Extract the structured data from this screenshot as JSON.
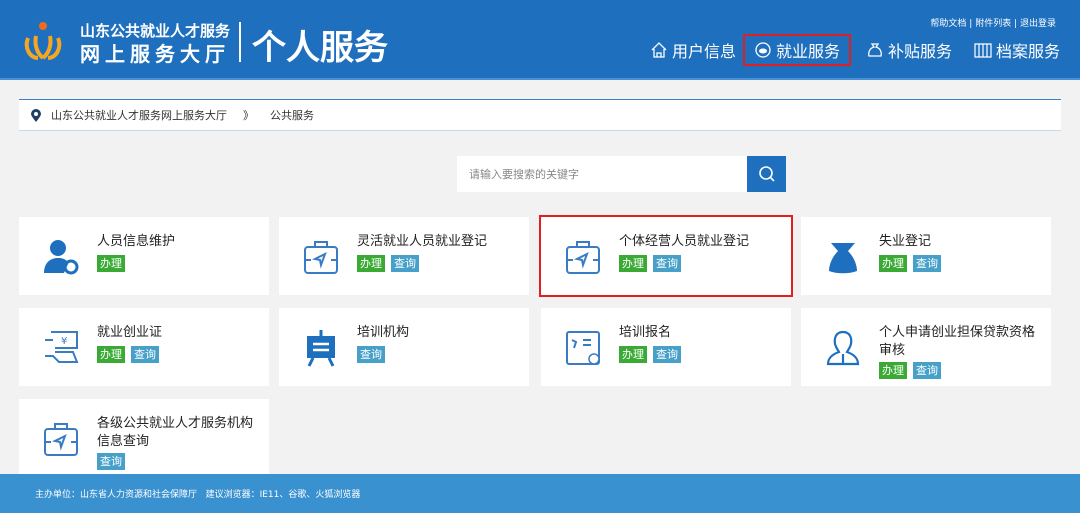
{
  "header": {
    "site_line1": "山东公共就业人才服务",
    "site_line2": "网上服务大厅",
    "page_title": "个人服务",
    "top_links": [
      "帮助文档",
      "附件列表",
      "退出登录"
    ],
    "nav": [
      {
        "label": "用户信息",
        "icon": "home-icon"
      },
      {
        "label": "就业服务",
        "icon": "employment-icon",
        "active": true
      },
      {
        "label": "补贴服务",
        "icon": "money-bag-icon"
      },
      {
        "label": "档案服务",
        "icon": "archive-icon"
      }
    ]
  },
  "breadcrumb": {
    "items": [
      "山东公共就业人才服务网上服务大厅",
      "公共服务"
    ],
    "separator": "》"
  },
  "search": {
    "placeholder": "请输入要搜索的关键字"
  },
  "badges": {
    "handle": "办理",
    "query": "查询"
  },
  "cards": [
    {
      "title": "人员信息维护",
      "icon": "user-wrench-icon"
    },
    {
      "title": "灵活就业人员就业登记",
      "icon": "briefcase-icon"
    },
    {
      "title": "个体经营人员就业登记",
      "icon": "briefcase-icon",
      "selected": true
    },
    {
      "title": "失业登记",
      "icon": "bag-icon"
    },
    {
      "title": "就业创业证",
      "icon": "certificate-icon"
    },
    {
      "title": "培训机构",
      "icon": "easel-icon"
    },
    {
      "title": "培训报名",
      "icon": "signup-icon"
    },
    {
      "title": "个人申请创业担保贷款资格审核",
      "icon": "person-icon"
    },
    {
      "title": "各级公共就业人才服务机构信息查询",
      "icon": "briefcase-icon"
    }
  ],
  "footer": {
    "text": "主办单位：山东省人力资源和社会保障厅   建议浏览器：IE11、谷歌、火狐浏览器"
  },
  "colors": {
    "header": "#1e6fbe",
    "handle": "#3aaa35",
    "query": "#46a0c8",
    "highlight": "#e02020"
  }
}
